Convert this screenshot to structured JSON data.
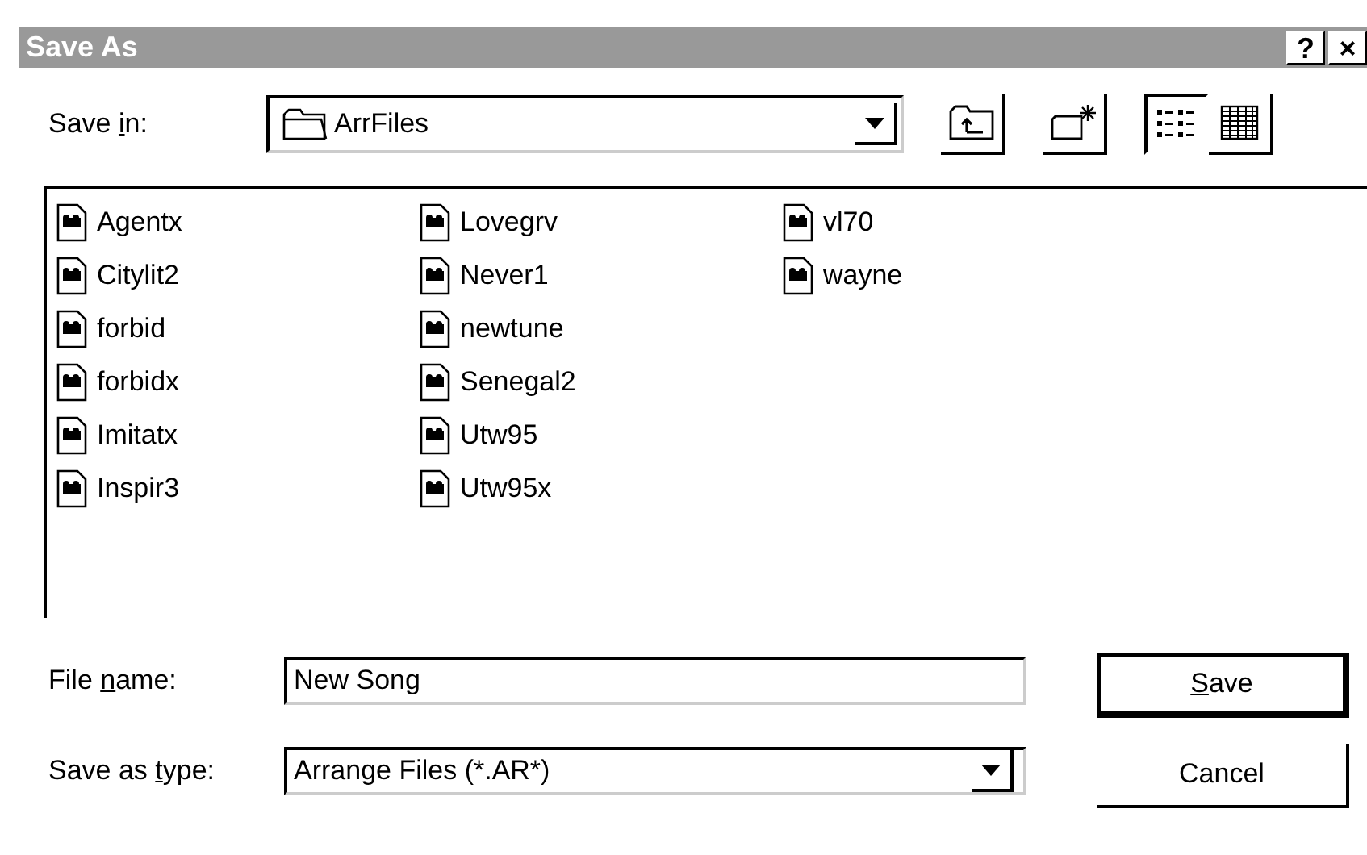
{
  "window": {
    "title": "Save As",
    "help_button": "?",
    "close_button": "×"
  },
  "save_in": {
    "label_before": "Save ",
    "label_key": "i",
    "label_after": "n:",
    "folder": "ArrFiles"
  },
  "view_buttons": [
    {
      "kind": "list",
      "selected": true
    },
    {
      "kind": "details",
      "selected": false
    }
  ],
  "files": [
    "Agentx",
    "Citylit2",
    "forbid",
    "forbidx",
    "Imitatx",
    "Inspir3",
    "Lovegrv",
    "Never1",
    "newtune",
    "Senegal2",
    "Utw95",
    "Utw95x",
    "vl70",
    "wayne"
  ],
  "file_name": {
    "label_before": "File ",
    "label_key": "n",
    "label_after": "ame:",
    "value": "New Song"
  },
  "save_as_type": {
    "label_before": "Save as ",
    "label_key": "t",
    "label_after": "ype:",
    "value": "Arrange Files (*.AR*)"
  },
  "buttons": [
    {
      "kind": "default",
      "label_key": "S",
      "label_after": "ave"
    },
    {
      "kind": "normal",
      "label_after": "Cancel"
    }
  ]
}
